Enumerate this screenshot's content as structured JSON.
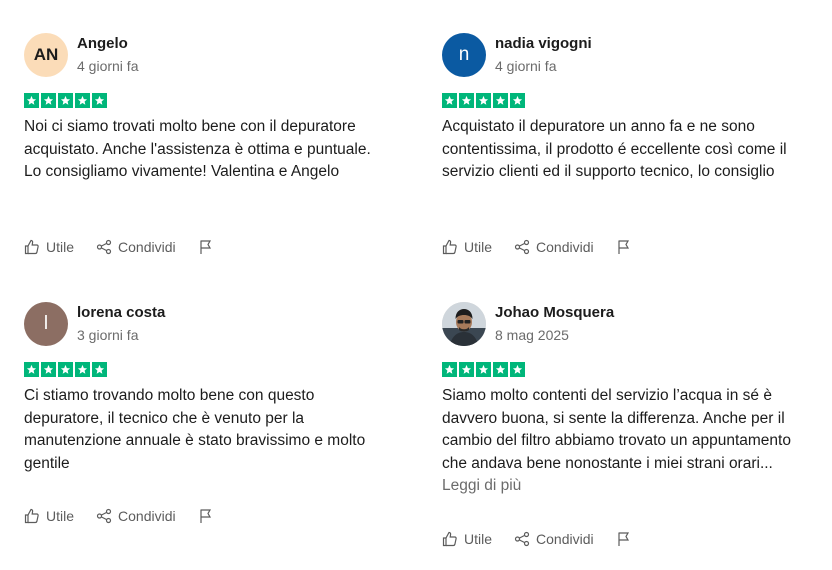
{
  "reviews": [
    {
      "avatar_text": "AN",
      "avatar_bg": "#fbdcb8",
      "avatar_fg": "#1c1c1c",
      "name": "Angelo",
      "date": "4 giorni fa",
      "rating": 5,
      "text": "Noi ci siamo trovati molto bene con il depuratore acquistato. Anche l'assistenza è ottima e puntuale. Lo consigliamo vivamente! Valentina e Angelo",
      "read_more": ""
    },
    {
      "avatar_text": "n",
      "avatar_bg": "#0b5aa2",
      "avatar_fg": "#ffffff",
      "name": "nadia vigogni",
      "date": "4 giorni fa",
      "rating": 5,
      "text": "Acquistato il depuratore un anno fa e ne sono contentissima, il prodotto é eccellente così come il servizio clienti ed il supporto tecnico, lo consiglio",
      "read_more": ""
    },
    {
      "avatar_text": "l",
      "avatar_bg": "#8c6e63",
      "avatar_fg": "#ffffff",
      "name": "lorena costa",
      "date": "3 giorni fa",
      "rating": 5,
      "text": "Ci stiamo trovando molto bene con questo depuratore, il tecnico che è venuto per la manutenzione annuale è stato bravissimo e molto gentile",
      "read_more": ""
    },
    {
      "avatar_text": "",
      "avatar_bg": "#d8d4cf",
      "avatar_fg": "#ffffff",
      "name": "Johao Mosquera",
      "date": "8 mag 2025",
      "rating": 5,
      "text": "Siamo molto contenti del servizio l’acqua in sé è davvero buona, si sente la differenza. Anche per il cambio del filtro abbiamo trovato un appuntamento che andava bene nonostante i miei strani orari...",
      "read_more": "Leggi di più"
    }
  ],
  "actions": {
    "useful_label": "Utile",
    "share_label": "Condividi"
  },
  "colors": {
    "star_green": "#00b67a"
  },
  "icons": [
    "thumbs-up-icon",
    "share-icon",
    "flag-icon",
    "star-icon"
  ]
}
